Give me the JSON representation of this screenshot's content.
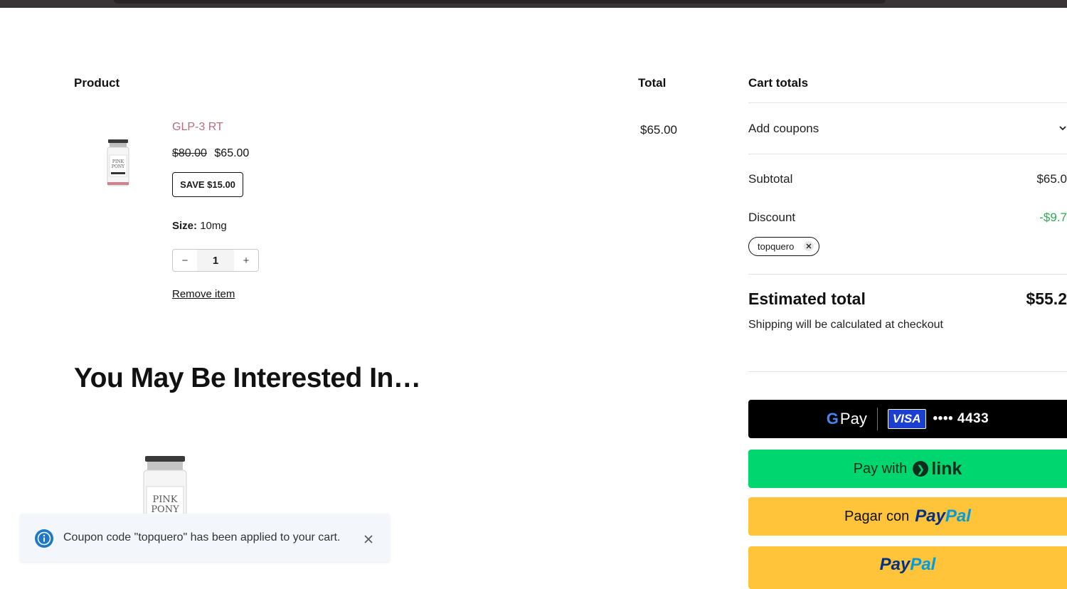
{
  "table": {
    "product_header": "Product",
    "total_header": "Total"
  },
  "item": {
    "name": "GLP-3 RT",
    "old_price": "$80.00",
    "new_price": "$65.00",
    "save_badge": "SAVE $15.00",
    "size_label": "Size:",
    "size_value": "10mg",
    "quantity": "1",
    "minus": "−",
    "plus": "+",
    "remove_label": "Remove item",
    "line_total": "$65.00"
  },
  "recommendations": {
    "heading": "You May Be Interested In…"
  },
  "toast": {
    "message": "Coupon code \"topquero\" has been applied to your cart."
  },
  "cart_totals": {
    "title": "Cart totals",
    "add_coupons": "Add coupons",
    "subtotal_label": "Subtotal",
    "subtotal_value": "$65.0",
    "discount_label": "Discount",
    "discount_value": "-$9.7",
    "coupon_code": "topquero",
    "estimated_label": "Estimated total",
    "estimated_value": "$55.2",
    "shipping_note": "Shipping will be calculated at checkout"
  },
  "payment": {
    "gpay_g": "G",
    "gpay_label": "Pay",
    "visa": "VISA",
    "card_digits": "•••• 4433",
    "link_prefix": "Pay with",
    "link_word": "link",
    "paypal_prefix": "Pagar con",
    "paypal_pay": "Pay",
    "paypal_pal": "Pal"
  },
  "colors": {
    "product_link": "#b46f7b",
    "discount": "#2eaa55",
    "gpay": "#000000",
    "link": "#00d66f",
    "paypal": "#ffc439"
  }
}
